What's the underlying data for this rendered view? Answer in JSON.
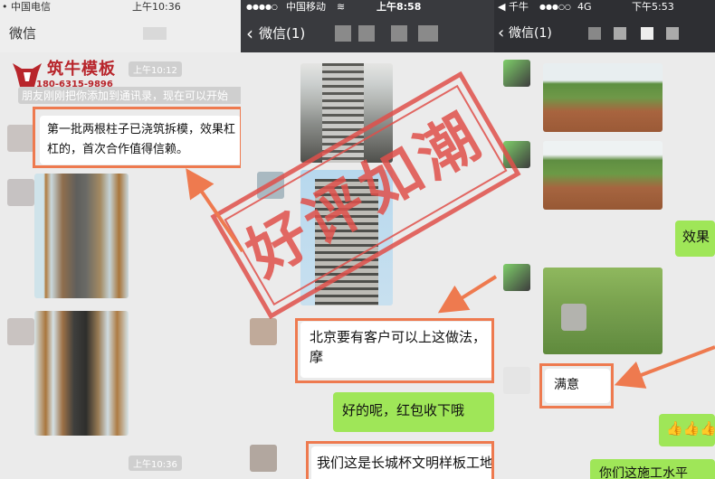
{
  "panel1": {
    "status": {
      "carrier": "中国电信",
      "time": "上午10:36"
    },
    "nav": {
      "title": "微信"
    },
    "logo": {
      "name": "筑牛模板",
      "phone": "180-6315-9896"
    },
    "time1": "上午10:12",
    "system_notice": "朋友刚刚把你添加到通讯录，现在可以开始",
    "message": "第一批两根柱子已浇筑拆模，效果杠杠的，首次合作值得信赖。",
    "time2": "上午10:36"
  },
  "panel2": {
    "status": {
      "signal": "●●●●○",
      "carrier": "中国移动",
      "time": "上午8:58"
    },
    "nav": {
      "back_label": "微信(1)"
    },
    "message1": "北京要有客户可以上这做法，摩",
    "message2": "好的呢，红包收下哦",
    "message3": "我们这是长城杯文明样板工地"
  },
  "panel3": {
    "status": {
      "carrier": "千牛",
      "signal": "●●●○○",
      "network": "4G",
      "time": "下午5:53"
    },
    "nav": {
      "back_label": "微信(1)"
    },
    "message_effect": "效果",
    "message_satisfied": "满意",
    "thumbs": "👍👍👍",
    "message_bottom": "你们这施工水平"
  },
  "watermark": "好评如潮",
  "colors": {
    "highlight": "#ee7a4f",
    "green_bubble": "#9fe658",
    "stamp": "#e0504b"
  }
}
